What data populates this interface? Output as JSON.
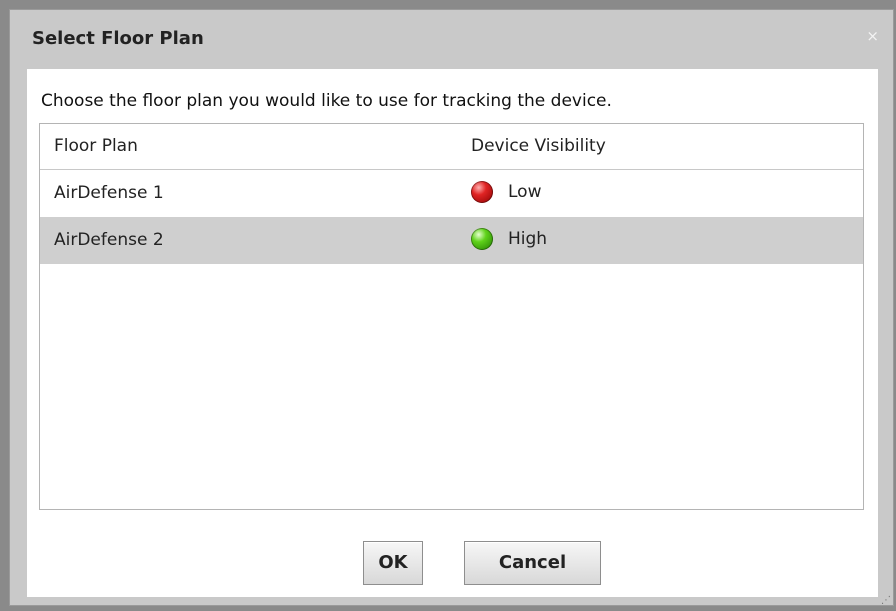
{
  "dialog": {
    "title": "Select Floor Plan",
    "close_glyph": "×",
    "prompt": "Choose the floor plan you would like to use for tracking the device.",
    "columns": {
      "floor_plan": "Floor Plan",
      "device_visibility": "Device Visibility"
    },
    "rows": [
      {
        "floor_plan": "AirDefense 1",
        "visibility": "Low",
        "indicator": "red-indicator-icon",
        "color": "#e02424",
        "selected": false
      },
      {
        "floor_plan": "AirDefense 2",
        "visibility": "High",
        "indicator": "green-indicator-icon",
        "color": "#5fd21a",
        "selected": true
      }
    ],
    "buttons": {
      "ok": "OK",
      "cancel": "Cancel"
    }
  }
}
